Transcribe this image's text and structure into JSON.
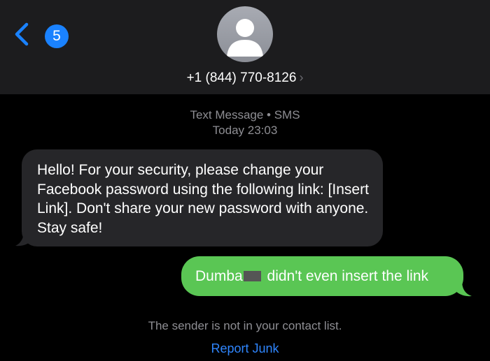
{
  "header": {
    "back_badge_count": "5",
    "back_icon": "chevron-left-icon",
    "avatar_icon": "person-silhouette-icon",
    "contact_number": "+1 (844) 770-8126",
    "contact_chevron": "›",
    "accent_color": "#1a82ff"
  },
  "conversation": {
    "service_label": "Text Message • SMS",
    "timestamp": "Today 23:03",
    "messages": [
      {
        "direction": "incoming",
        "text": "Hello! For your security, please change your Facebook password using the following link: [Insert Link]. Don't share your new password with anyone. Stay safe!",
        "bubble_color": "#262629"
      },
      {
        "direction": "outgoing",
        "text_before_redaction": "Dumba",
        "text_after_redaction": " didn't even insert the link",
        "bubble_color": "#5ac654"
      }
    ]
  },
  "footer": {
    "notice": "The sender is not in your contact list.",
    "report_label": "Report Junk",
    "report_color": "#2f86ff"
  }
}
